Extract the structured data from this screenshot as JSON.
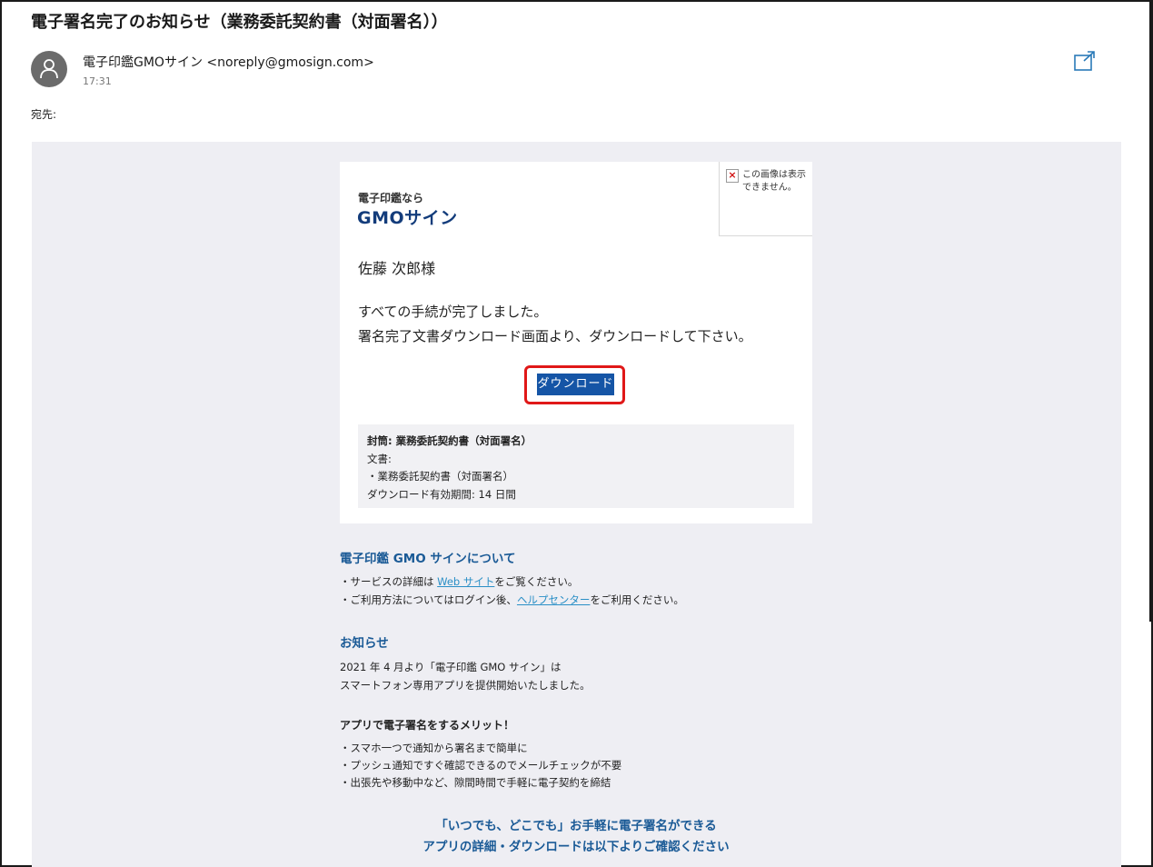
{
  "email": {
    "subject": "電子署名完了のお知らせ（業務委託契約書（対面署名））",
    "sender": "電子印鑑GMOサイン <noreply@gmosign.com>",
    "time": "17:31",
    "to_label": "宛先:"
  },
  "card": {
    "logo_small": "電子印鑑なら",
    "logo_big": "GMOサイン",
    "broken_image_text": "この画像は表示できません。",
    "greeting": "佐藤 次郎様",
    "message_line1": "すべての手続が完了しました。",
    "message_line2": "署名完了文書ダウンロード画面より、ダウンロードして下さい。",
    "download_button": "ダウンロード",
    "info": {
      "envelope": "封筒: 業務委託契約書（対面署名）",
      "doc_label": "文書:",
      "doc_item": "・業務委託契約書（対面署名）",
      "period": "ダウンロード有効期間: 14 日間"
    }
  },
  "about": {
    "title": "電子印鑑 GMO サインについて",
    "line1_pre": "・サービスの詳細は ",
    "line1_link": "Web サイト",
    "line1_post": "をご覧ください。",
    "line2_pre": "・ご利用方法についてはログイン後、",
    "line2_link": "ヘルプセンター",
    "line2_post": "をご利用ください。"
  },
  "notice": {
    "title": "お知らせ",
    "line1": "2021 年 4 月より「電子印鑑 GMO サイン」は",
    "line2": "スマートフォン専用アプリを提供開始いたしました。",
    "merit_title": "アプリで電子署名をするメリット！",
    "merits": [
      "・スマホ一つで通知から署名まで簡単に",
      "・プッシュ通知ですぐ確認できるのでメールチェックが不要",
      "・出張先や移動中など、隙間時間で手軽に電子契約を締結"
    ],
    "cta_line1": "「いつでも、どこでも」お手軽に電子署名ができる",
    "cta_line2": "アプリの詳細・ダウンロードは以下よりご確認ください"
  },
  "colors": {
    "accent": "#1a5a96",
    "button": "#1555a6",
    "highlight": "#e01818",
    "mail_background": "#eeeef3"
  },
  "icons": [
    "person-icon",
    "popout-icon",
    "broken-image-icon"
  ]
}
